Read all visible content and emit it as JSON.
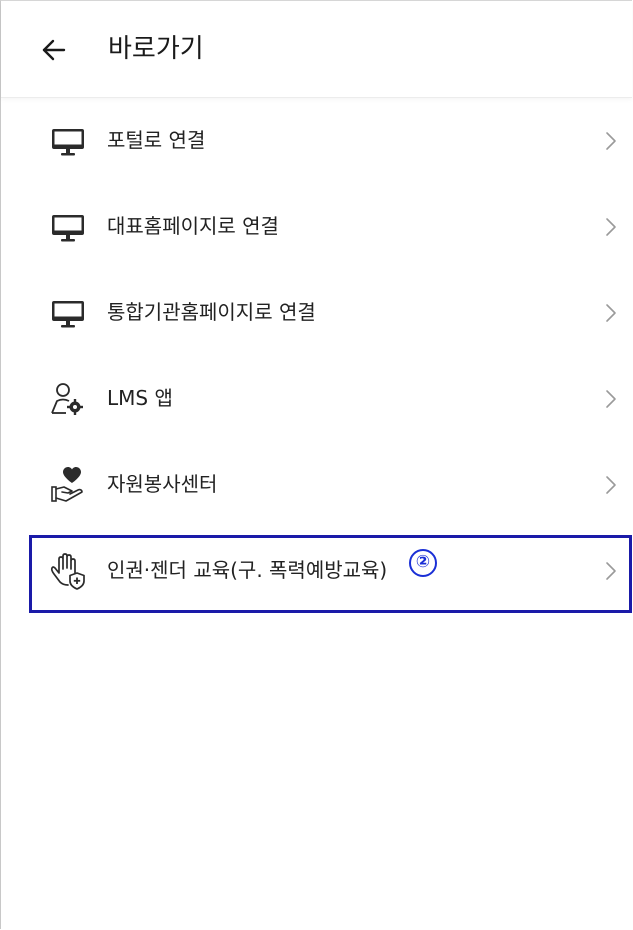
{
  "header": {
    "back_icon": "arrow-left-icon",
    "title": "바로가기"
  },
  "menu": {
    "items": [
      {
        "label": "포털로 연결",
        "icon": "monitor-icon"
      },
      {
        "label": "대표홈페이지로 연결",
        "icon": "monitor-icon"
      },
      {
        "label": "통합기관홈페이지로 연결",
        "icon": "monitor-icon"
      },
      {
        "label": "LMS 앱",
        "icon": "person-gear-icon"
      },
      {
        "label": "자원봉사센터",
        "icon": "heart-hand-icon"
      },
      {
        "label": "인권·젠더 교육(구. 폭력예방교육)",
        "icon": "hand-shield-icon"
      }
    ],
    "chevron_icon": "chevron-right-icon"
  },
  "annotation": {
    "step_number": "②",
    "highlight_color": "#1a1aa8",
    "badge_color": "#1a2fd6"
  }
}
